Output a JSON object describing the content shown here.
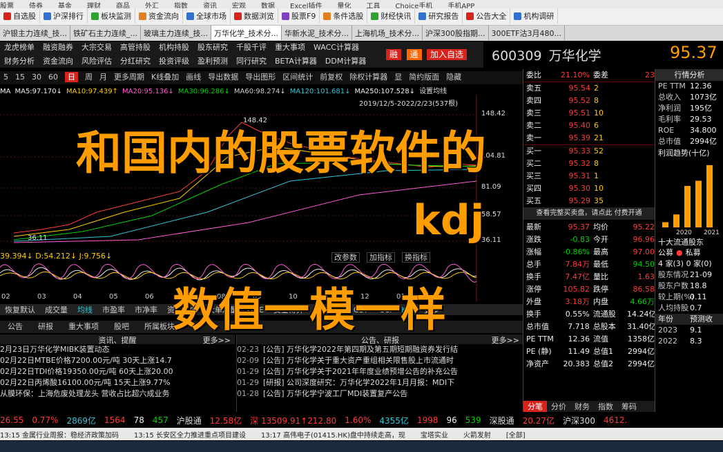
{
  "top_menu": [
    "股票",
    "债券",
    "基金",
    "理财",
    "商品",
    "外汇",
    "指数",
    "资讯",
    "宏观",
    "数据",
    "Excel插件",
    "量化",
    "工具",
    "Choice手机",
    "手机APP"
  ],
  "toolbar": [
    "自选股",
    "沪深排行",
    "板块监测",
    "资金流向",
    "全球市场",
    "数据浏览",
    "股票F9",
    "条件选股",
    "财经快讯",
    "研究报告",
    "公告大全",
    "机构调研"
  ],
  "tabs": [
    "沪银主力连续_技...",
    "铁矿石主力连续_...",
    "玻璃主力连续_技...",
    "万华化学_技术分...",
    "华新水泥_技术分...",
    "上海机场_技术分...",
    "沪深300股指期...",
    "300ETF沽3月480..."
  ],
  "nav1": [
    "龙虎榜单",
    "融资融券",
    "大宗交易",
    "高管持股",
    "机构持股",
    "股东研究",
    "千股千评",
    "重大事项",
    "WACC计算器"
  ],
  "nav2": [
    "财务分析",
    "资金流向",
    "风险评估",
    "分红研究",
    "投资评级",
    "盈利预测",
    "同行研究",
    "BETA计算器",
    "DDM计算器"
  ],
  "buttons": {
    "rong": "融",
    "tong": "通",
    "add": "加入自选"
  },
  "stock": {
    "code": "600309",
    "name": "万华化学",
    "price": "95.37"
  },
  "period_bar": [
    "5",
    "15",
    "30",
    "60",
    "日",
    "周",
    "月",
    "更多周期",
    "K线叠加",
    "画线",
    "导出数据",
    "导出图形",
    "区间统计",
    "前复权",
    "除权计算器",
    "显",
    "简约版面",
    "隐藏"
  ],
  "ma": [
    {
      "t": "MA",
      "c": "#eeeeee"
    },
    {
      "t": "MA5:97.170↓",
      "c": "#eeeeee"
    },
    {
      "t": "MA10:97.439↑",
      "c": "#ffcc00"
    },
    {
      "t": "MA20:95.136↓",
      "c": "#ff5ad2"
    },
    {
      "t": "MA30:96.286↓",
      "c": "#00d200"
    },
    {
      "t": "MA60:98.274↓",
      "c": "#cccccc"
    },
    {
      "t": "MA120:101.681↓",
      "c": "#31c6d8"
    },
    {
      "t": "MA250:107.528↓",
      "c": "#eeeeee"
    },
    {
      "t": "设置均线",
      "c": "#dddddd"
    }
  ],
  "chart": {
    "date_range": "2019/12/5-2022/2/23(537根)",
    "high_label": "148.42",
    "low_label": "36.11",
    "axis_ticks": [
      "148.42",
      "104.81",
      "81.09",
      "58.57",
      "36.11"
    ],
    "kdj_values": "39.394↓  D:54.212↓  J:9.756↓",
    "ind_buttons": [
      "改参数",
      "加指标",
      "换指标"
    ],
    "x_ticks": [
      "02",
      "03",
      "04",
      "05",
      "06",
      "07",
      "08",
      "09",
      "10",
      "11",
      "12",
      "01",
      "02"
    ]
  },
  "bottom_tabs1": [
    "恢复默认",
    "成交量",
    "均线",
    "市盈率",
    "市净率",
    "资金流向",
    "大单净量",
    "DDE",
    "资金博弈",
    "资金趋势",
    "CDP",
    "CCI",
    "KDJ",
    "更多"
  ],
  "bottom_tabs2": [
    "公告",
    "研报",
    "重大事项",
    "股吧",
    "所属板块"
  ],
  "news_left": {
    "title": "资讯、提醒",
    "more": "更多>>",
    "items": [
      "2月23日万华化学MIBK装置动态",
      "02月22日MTBE价格7200.00元/吨 30天上涨14.7",
      "02月22日TDI价格19350.00元/吨 60天上涨20.00",
      "02月22日丙烯酸16100.00元/吨 15天上涨9.77%",
      "从膜环保：上海危废处理龙头 营收占比超六成业务"
    ]
  },
  "news_right": {
    "title": "公告、研报",
    "more": "更多>>",
    "items": [
      {
        "d": "02-23",
        "t": "[公告] 万华化学2022年第四期及第五期短期融资券发行结"
      },
      {
        "d": "02-09",
        "t": "[公告] 万华化学关于重大资产重组相关限售股上市流通时"
      },
      {
        "d": "01-29",
        "t": "[公告] 万华化学关于2021年年度业绩预增公告的补充公告"
      },
      {
        "d": "01-29",
        "t": "[研报] 公司深度研究：万华化学2022年1月月报：MDI下"
      },
      {
        "d": "01-28",
        "t": "[公告] 万华化学宁波工厂MDI装置复产公告"
      }
    ]
  },
  "orderbook": {
    "weibi": "委比",
    "weibi_v": "21.10%",
    "weicha": "委差",
    "weicha_v": "23",
    "asks": [
      [
        "卖五",
        "95.54",
        "2"
      ],
      [
        "卖四",
        "95.52",
        "8"
      ],
      [
        "卖三",
        "95.51",
        "10"
      ],
      [
        "卖二",
        "95.40",
        "6"
      ],
      [
        "卖一",
        "95.39",
        "21"
      ]
    ],
    "bids": [
      [
        "买一",
        "95.33",
        "52"
      ],
      [
        "买二",
        "95.32",
        "8"
      ],
      [
        "买三",
        "95.31",
        "1"
      ],
      [
        "买四",
        "95.30",
        "10"
      ],
      [
        "买五",
        "95.29",
        "35"
      ]
    ],
    "note": "查看完整买卖盘，请点此 付费开通"
  },
  "quote": [
    [
      "最新",
      "95.37",
      "均价",
      "95.22"
    ],
    [
      "涨跌",
      "-0.83",
      "今开",
      "96.96"
    ],
    [
      "涨幅",
      "-0.86%",
      "最高",
      "97.00"
    ],
    [
      "总手",
      "7.84万",
      "最低",
      "94.50"
    ],
    [
      "换手",
      "7.47亿",
      "量比",
      "1.63"
    ],
    [
      "涨停",
      "105.82",
      "跌停",
      "86.58"
    ],
    [
      "外盘",
      "3.18万",
      "内盘",
      "4.66万"
    ],
    [
      "换手",
      "0.55%",
      "流通股",
      "14.24亿"
    ],
    [
      "总市值",
      "7.718",
      "总股本",
      "31.40亿"
    ],
    [
      "PE TTM",
      "12.36",
      "流值",
      "1358亿"
    ],
    [
      "PE (静)",
      "11.49",
      "总值1",
      "2994亿"
    ],
    [
      "净资产",
      "20.383",
      "总值2",
      "2994亿"
    ]
  ],
  "rp_tabs": [
    "分笔",
    "分价",
    "财务",
    "指数",
    "筹码"
  ],
  "analysis": {
    "title": "行情分析",
    "rows": [
      [
        "PE TTM",
        "12.36"
      ],
      [
        "总收入",
        "1073亿"
      ],
      [
        "净利润",
        "195亿"
      ],
      [
        "毛利率",
        "29.53"
      ],
      [
        "ROE",
        "34.800"
      ],
      [
        "总市值",
        "2994亿"
      ]
    ],
    "trend_title": "利润趋势(十亿)",
    "bars": [
      2,
      5,
      16,
      18,
      24
    ],
    "bar_labels": [
      "2020",
      "2021"
    ],
    "shareholders": "十大流通股东",
    "share_row": [
      "公募",
      "私募"
    ],
    "share_cnt": "4 家(3)   0 家(0)",
    "more_rows": [
      [
        "股东情况",
        "21-09"
      ],
      [
        "股东户数",
        "18.8"
      ],
      [
        "较上期(%)",
        "0.11"
      ],
      [
        "人均持股",
        "0.7"
      ]
    ],
    "fc_title": [
      "年份",
      "预测收"
    ],
    "forecast": [
      [
        "2023",
        "9.1"
      ],
      [
        "2022",
        "8.3"
      ]
    ]
  },
  "status": [
    {
      "t": "26.55",
      "c": "#ff3b3b"
    },
    {
      "t": "0.77%",
      "c": "#ff3b3b"
    },
    {
      "t": "2869亿",
      "c": "#31c6d8"
    },
    {
      "t": "1564",
      "c": "#ff3b3b"
    },
    {
      "t": "78",
      "c": "#eeeeee"
    },
    {
      "t": "457",
      "c": "#00d200"
    },
    {
      "t": "沪股通",
      "c": "#dddddd"
    },
    {
      "t": "12.58亿",
      "c": "#ff3b3b"
    },
    {
      "t": "深 13509.91↑212.80",
      "c": "#ff3b3b"
    },
    {
      "t": "1.60%",
      "c": "#ff3b3b"
    },
    {
      "t": "4355亿",
      "c": "#31c6d8"
    },
    {
      "t": "1998",
      "c": "#ff3b3b"
    },
    {
      "t": "96",
      "c": "#eeeeee"
    },
    {
      "t": "539",
      "c": "#00d200"
    },
    {
      "t": "深股通",
      "c": "#dddddd"
    },
    {
      "t": "20.27亿",
      "c": "#ff3b3b"
    },
    {
      "t": "沪深300",
      "c": "#dddddd"
    },
    {
      "t": "4612.",
      "c": "#ff3b3b"
    }
  ],
  "ticker": [
    "13:15 金属行业周报：稳经济政策加码",
    "13:15 长安区全力推进重点项目建设",
    "13:17 高伟电子(01415.HK)盘中持续走高，现",
    "宝塔实业",
    "火箭发射",
    "[全部]"
  ],
  "overlay": {
    "line1": "和国内的股票软件的",
    "line2": "kdj",
    "line3": "数值一模一样"
  }
}
